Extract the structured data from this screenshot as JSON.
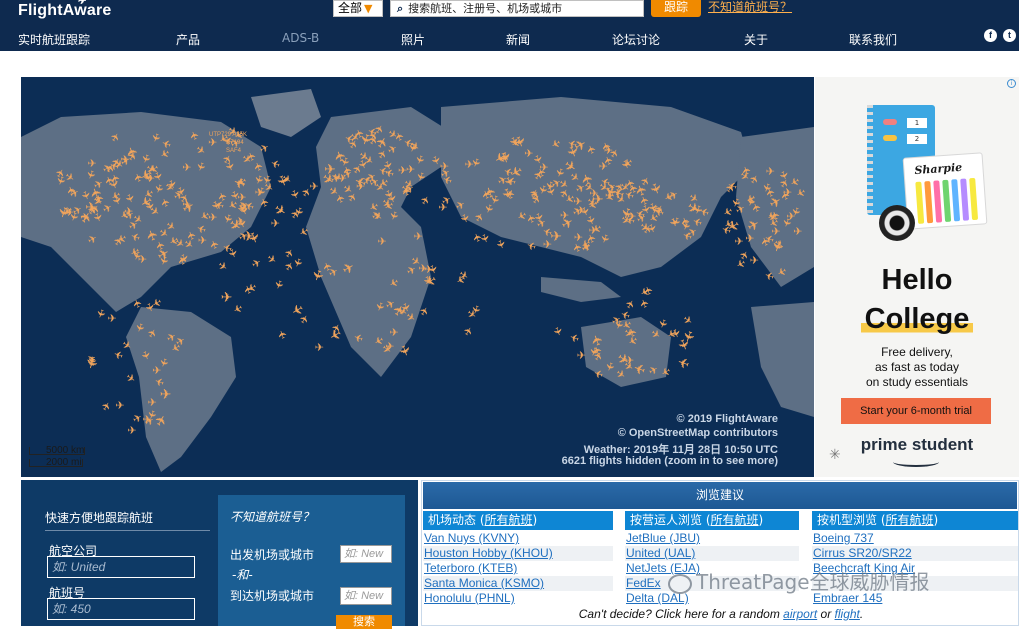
{
  "header": {
    "logo": "FlightAware",
    "scope_select": "全部",
    "search_placeholder": "搜索航班、注册号、机场或城市",
    "track_button": "跟踪",
    "unknown_flight_link": "不知道航班号？",
    "nav": [
      "实时航班跟踪",
      "产品",
      "ADS-B",
      "照片",
      "新闻",
      "论坛讨论",
      "关于",
      "联系我们"
    ],
    "social": [
      "facebook-icon",
      "twitter-icon"
    ]
  },
  "map": {
    "flight_labels": [
      "UTP729 A35K",
      "N7194",
      "SAF4"
    ],
    "credit_flightaware": "© 2019 FlightAware",
    "credit_osm": "© OpenStreetMap contributors",
    "weather": "Weather: 2019年 11月 28日 10:50 UTC",
    "hidden": "6621 flights hidden (zoom in to see more)",
    "scale_km": "5000 km",
    "scale_mi": "2000 mi"
  },
  "ad": {
    "pack_brand": "Sharpie",
    "notebook_tags": [
      "1",
      "2"
    ],
    "headline_1": "Hello",
    "headline_2": "College",
    "desc_1": "Free delivery,",
    "desc_2": "as fast as today",
    "desc_3": "on study essentials",
    "cta": "Start your 6-month trial",
    "brand": "prime student",
    "colors": {
      "accent": "#ef6c45",
      "highlight": "#f7c948"
    }
  },
  "quick_track": {
    "title": "快速方便地跟踪航班",
    "airline_label": "航空公司",
    "airline_placeholder": "如: United",
    "flight_label": "航班号",
    "flight_placeholder": "如: 450",
    "panel_title": "不知道航班号？",
    "origin_label": "出发机场或城市",
    "and_label": "-和-",
    "dest_label": "到达机场或城市",
    "origin_placeholder": "如: New",
    "dest_placeholder": "如: New",
    "search_button": "搜索"
  },
  "browse": {
    "title": "浏览建议",
    "columns": [
      {
        "head": "机场动态",
        "all": "所有航班",
        "items": [
          "Van Nuys (KVNY)",
          "Houston Hobby (KHOU)",
          "Teterboro (KTEB)",
          "Santa Monica (KSMO)",
          "Honolulu (PHNL)"
        ]
      },
      {
        "head": "按营运人浏览",
        "all": "所有航班",
        "items": [
          "JetBlue (JBU)",
          "United (UAL)",
          "NetJets (EJA)",
          "FedEx",
          "Delta (DAL)"
        ]
      },
      {
        "head": "按机型浏览",
        "all": "所有航班",
        "items": [
          "Boeing 737",
          "Cirrus SR20/SR22",
          "Beechcraft King Air",
          "",
          "Embraer 145"
        ]
      }
    ],
    "random_prefix": "Can't decide? Click here for a random ",
    "random_airport": "airport",
    "random_or": " or ",
    "random_flight": "flight",
    "random_suffix": "."
  },
  "watermark": "ThreatPage全球威胁情报",
  "colors": {
    "nav_bg": "#0e2a4f",
    "accent": "#f08a00",
    "plane": "#f0a45c",
    "ocean": "#0c2d55",
    "link": "#1f6fbf"
  }
}
